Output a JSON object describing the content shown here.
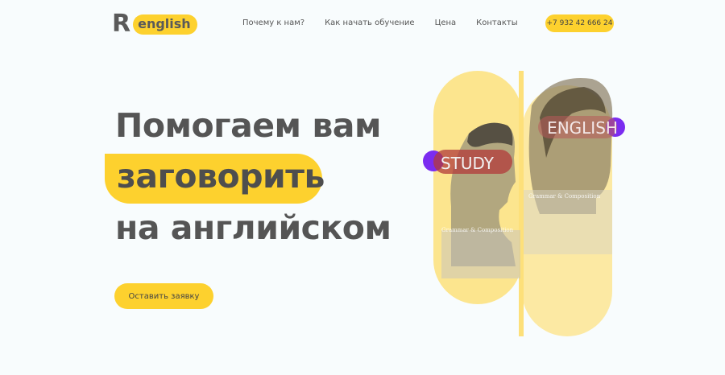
{
  "header": {
    "logo_letter": "R",
    "logo_word": "english",
    "nav": [
      "Почему к нам?",
      "Как начать обучение",
      "Цена",
      "Контакты"
    ],
    "phone": "+7 932 42 666 24"
  },
  "hero": {
    "line1": "Помогаем вам",
    "line2": "заговорить",
    "line3": "на английском",
    "cta": "Оставить заявку"
  },
  "art": {
    "tag_study": "STUDY",
    "tag_english": "ENGLISH",
    "book1": "Grammar & Composition",
    "book2": "Grammar & Composition"
  },
  "colors": {
    "accent": "#fdd12e",
    "purple": "#7b2cf0",
    "text": "#555555"
  }
}
